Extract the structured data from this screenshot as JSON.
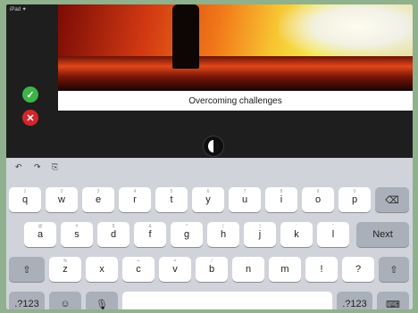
{
  "status_bar": {
    "text": "iPad ✦"
  },
  "caption": {
    "text": "Overcoming challenges"
  },
  "actions": {
    "confirm_icon": "✓",
    "discard_icon": "✕"
  },
  "toolbar": {
    "undo": "↶",
    "redo": "↷",
    "paste": "⎘"
  },
  "keyboard": {
    "row1": [
      "q",
      "w",
      "e",
      "r",
      "t",
      "y",
      "u",
      "i",
      "o",
      "p"
    ],
    "row1_hints": [
      "1",
      "2",
      "3",
      "4",
      "5",
      "6",
      "7",
      "8",
      "9",
      "0"
    ],
    "row2": [
      "a",
      "s",
      "d",
      "f",
      "g",
      "h",
      "j",
      "k",
      "l"
    ],
    "row2_hints": [
      "@",
      "#",
      "$",
      "&",
      "*",
      "(",
      ")",
      "'",
      "\""
    ],
    "row3": [
      "z",
      "x",
      "c",
      "v",
      "b",
      "n",
      "m",
      "!",
      "?"
    ],
    "row3_hints": [
      "%",
      "-",
      "+",
      "=",
      "/",
      ";",
      ":",
      ",",
      "."
    ],
    "delete_icon": "⌫",
    "next_label": "Next",
    "shift_icon": "⇧",
    "numbers_label": ".?123",
    "emoji_icon": "☺",
    "mic_icon": "🎙",
    "numbers_right_label": ".?123",
    "hide_icon": "⌨"
  }
}
